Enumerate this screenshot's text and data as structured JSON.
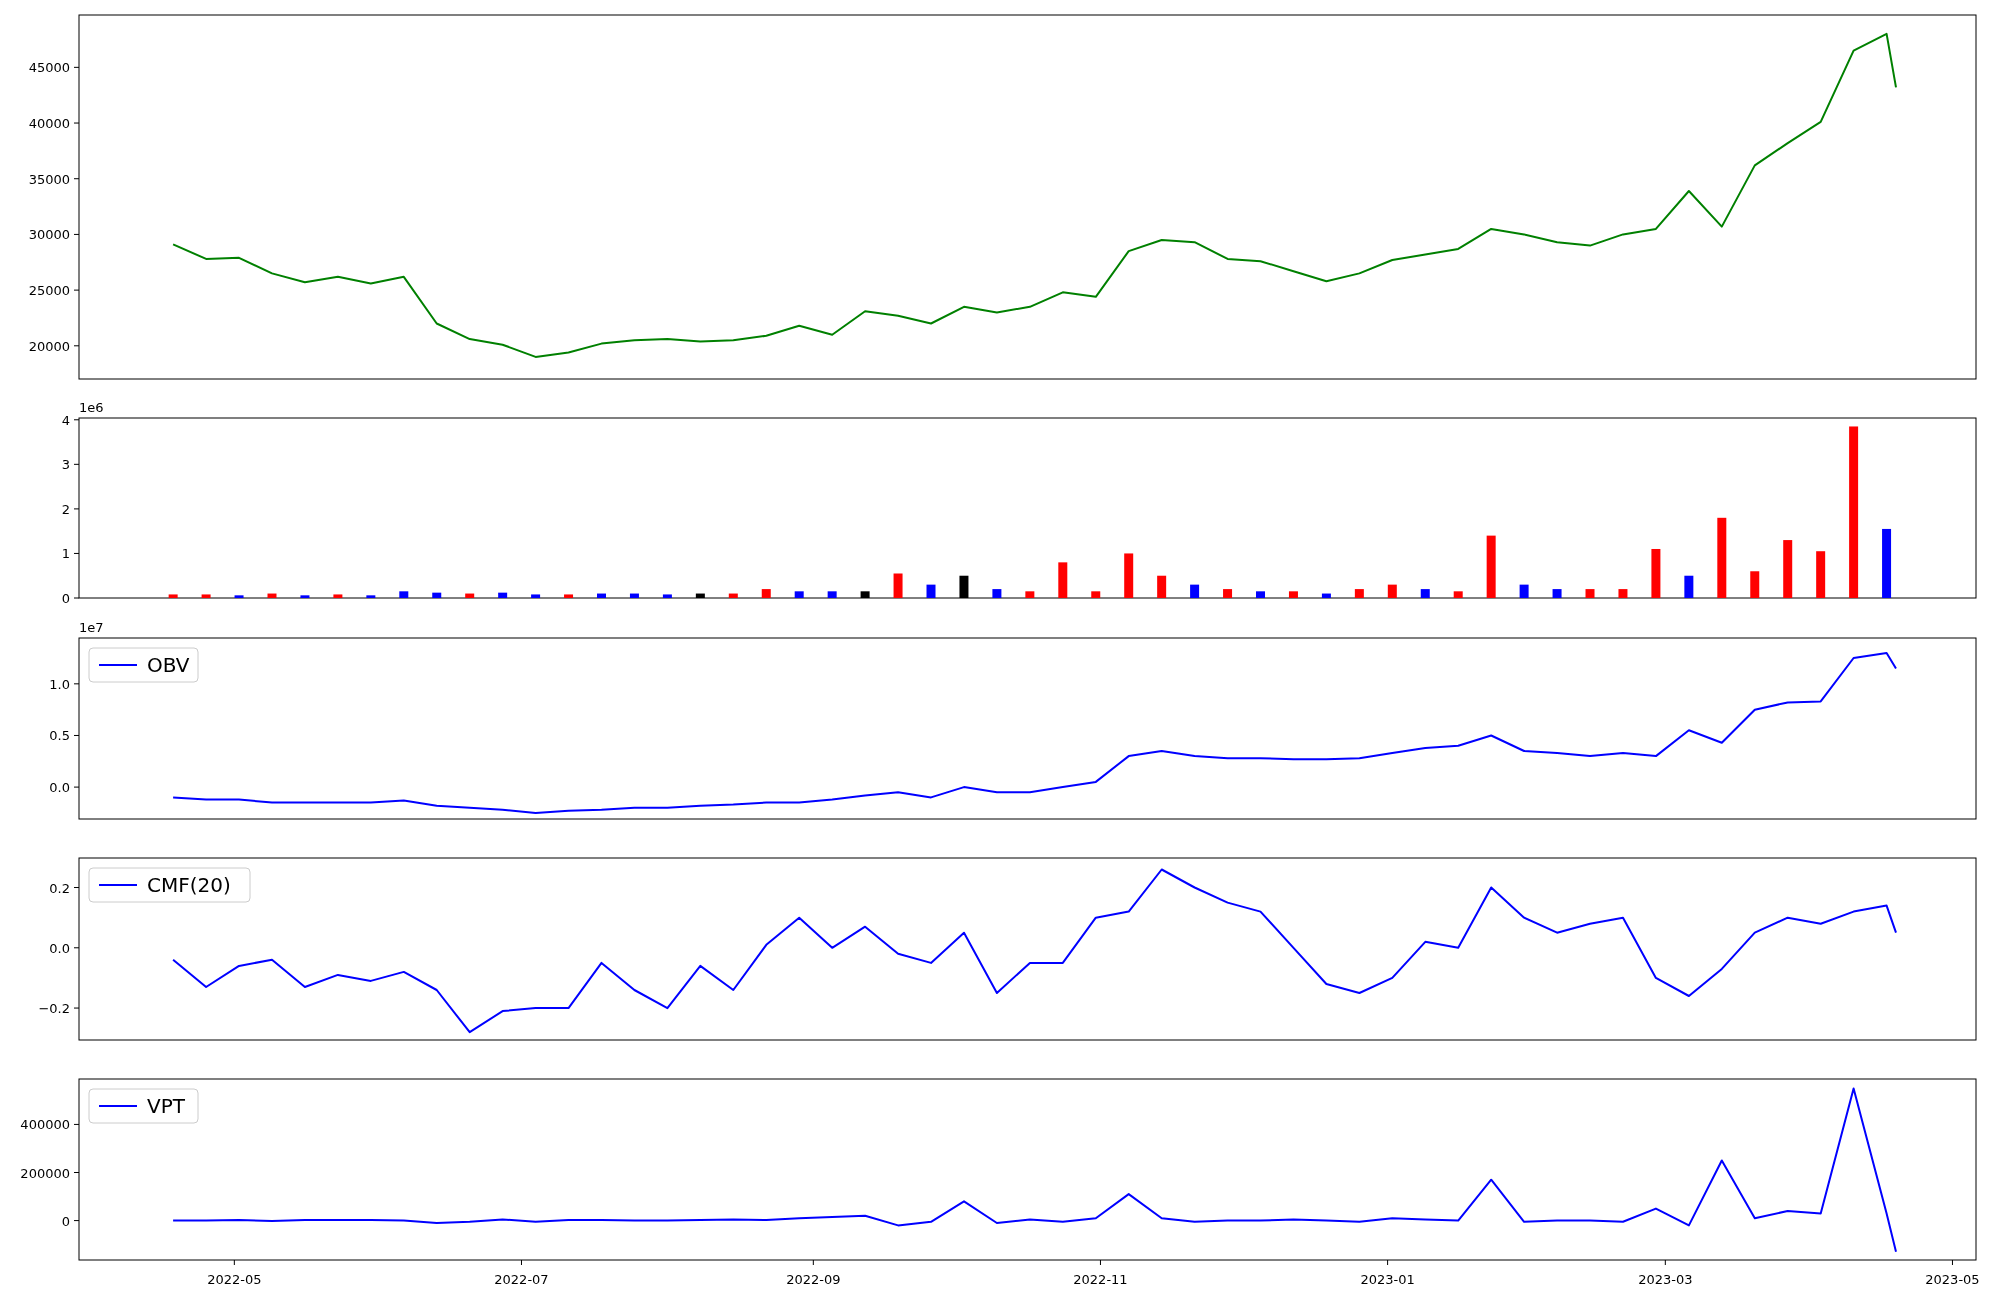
{
  "figure": {
    "panels": [
      {
        "chart_data": {
          "type": "line",
          "xlim": [
            "2022-03-29",
            "2023-05-06"
          ],
          "ylim": [
            17020,
            49700
          ],
          "yticks": [
            20000,
            25000,
            30000,
            35000,
            40000,
            45000
          ],
          "x": [
            "2022-04-18",
            "2022-04-25",
            "2022-05-02",
            "2022-05-09",
            "2022-05-16",
            "2022-05-23",
            "2022-05-30",
            "2022-06-06",
            "2022-06-13",
            "2022-06-20",
            "2022-06-27",
            "2022-07-04",
            "2022-07-11",
            "2022-07-18",
            "2022-07-25",
            "2022-08-01",
            "2022-08-08",
            "2022-08-15",
            "2022-08-22",
            "2022-08-29",
            "2022-09-05",
            "2022-09-12",
            "2022-09-19",
            "2022-09-26",
            "2022-10-03",
            "2022-10-10",
            "2022-10-17",
            "2022-10-24",
            "2022-10-31",
            "2022-11-07",
            "2022-11-14",
            "2022-11-21",
            "2022-11-28",
            "2022-12-05",
            "2022-12-12",
            "2022-12-19",
            "2022-12-26",
            "2023-01-02",
            "2023-01-09",
            "2023-01-16",
            "2023-01-23",
            "2023-01-30",
            "2023-02-06",
            "2023-02-13",
            "2023-02-20",
            "2023-02-27",
            "2023-03-06",
            "2023-03-13",
            "2023-03-20",
            "2023-03-27",
            "2023-04-03",
            "2023-04-10",
            "2023-04-17",
            "2023-04-19"
          ],
          "series": [
            {
              "color": "#008000",
              "values": [
                29100,
                27800,
                27900,
                26500,
                25700,
                26200,
                25600,
                26200,
                22000,
                20600,
                20100,
                19000,
                19400,
                20200,
                20500,
                20600,
                20400,
                20500,
                20900,
                21800,
                21000,
                23100,
                22700,
                22000,
                23500,
                23000,
                23500,
                24800,
                24400,
                28500,
                29500,
                29300,
                27800,
                27600,
                26700,
                25800,
                26500,
                27700,
                28200,
                28700,
                30500,
                30000,
                29300,
                29000,
                30000,
                30500,
                33900,
                30700,
                36200,
                38200,
                40100,
                46500,
                48000,
                43200
              ]
            }
          ]
        }
      },
      {
        "chart_data": {
          "type": "bar",
          "xlim": [
            "2022-03-29",
            "2023-05-06"
          ],
          "ylim": [
            0,
            4.04
          ],
          "yticks": [
            0,
            1,
            2,
            3,
            4
          ],
          "annotations": [
            {
              "text": "1e6"
            }
          ],
          "x": [
            "2022-04-18",
            "2022-04-25",
            "2022-05-02",
            "2022-05-09",
            "2022-05-16",
            "2022-05-23",
            "2022-05-30",
            "2022-06-06",
            "2022-06-13",
            "2022-06-20",
            "2022-06-27",
            "2022-07-04",
            "2022-07-11",
            "2022-07-18",
            "2022-07-25",
            "2022-08-01",
            "2022-08-08",
            "2022-08-15",
            "2022-08-22",
            "2022-08-29",
            "2022-09-05",
            "2022-09-12",
            "2022-09-19",
            "2022-09-26",
            "2022-10-03",
            "2022-10-10",
            "2022-10-17",
            "2022-10-24",
            "2022-10-31",
            "2022-11-07",
            "2022-11-14",
            "2022-11-21",
            "2022-11-28",
            "2022-12-05",
            "2022-12-12",
            "2022-12-19",
            "2022-12-26",
            "2023-01-02",
            "2023-01-09",
            "2023-01-16",
            "2023-01-23",
            "2023-01-30",
            "2023-02-06",
            "2023-02-13",
            "2023-02-20",
            "2023-02-27",
            "2023-03-06",
            "2023-03-13",
            "2023-03-20",
            "2023-03-27",
            "2023-04-03",
            "2023-04-10",
            "2023-04-17"
          ],
          "series": [
            {
              "color": "#ff0000",
              "values": [
                0.08,
                0.08,
                null,
                0.1,
                null,
                0.08,
                null,
                null,
                null,
                0.1,
                null,
                null,
                0.08,
                null,
                null,
                null,
                null,
                0.1,
                0.2,
                null,
                null,
                null,
                0.55,
                null,
                null,
                null,
                0.15,
                0.8,
                0.15,
                1.0,
                0.5,
                null,
                0.2,
                null,
                0.15,
                null,
                0.2,
                0.3,
                null,
                0.15,
                1.4,
                null,
                null,
                0.2,
                0.2,
                1.1,
                null,
                1.8,
                0.6,
                1.3,
                1.05,
                3.85,
                null
              ]
            },
            {
              "color": "#0000ff",
              "values": [
                null,
                null,
                0.06,
                null,
                0.06,
                null,
                0.06,
                0.15,
                0.12,
                null,
                0.12,
                0.08,
                null,
                0.1,
                0.1,
                0.08,
                null,
                null,
                null,
                0.15,
                0.15,
                null,
                null,
                0.3,
                null,
                0.2,
                null,
                null,
                null,
                null,
                null,
                0.3,
                null,
                0.15,
                null,
                0.1,
                null,
                null,
                0.2,
                null,
                null,
                0.3,
                0.2,
                null,
                null,
                null,
                0.5,
                null,
                null,
                null,
                null,
                null,
                1.55
              ]
            },
            {
              "color": "#000000",
              "values": [
                null,
                null,
                null,
                null,
                null,
                null,
                null,
                null,
                null,
                null,
                null,
                null,
                null,
                null,
                null,
                null,
                0.1,
                null,
                null,
                null,
                null,
                0.15,
                null,
                null,
                0.5,
                null,
                null,
                null,
                null,
                null,
                null,
                null,
                null,
                null,
                null,
                null,
                null,
                null,
                null,
                null,
                null,
                null,
                null,
                null,
                null,
                null,
                null,
                null,
                null,
                null,
                null,
                null,
                null
              ]
            }
          ]
        }
      },
      {
        "chart_data": {
          "type": "line",
          "xlim": [
            "2022-03-29",
            "2023-05-06"
          ],
          "ylim": [
            -0.309,
            1.444
          ],
          "yticks": [
            {
              "value": 0,
              "label": "0.0"
            },
            {
              "value": 0.5,
              "label": "0.5"
            },
            {
              "value": 1,
              "label": "1.0"
            }
          ],
          "annotations": [
            {
              "text": "1e7"
            }
          ],
          "x": [
            "2022-04-18",
            "2022-04-25",
            "2022-05-02",
            "2022-05-09",
            "2022-05-16",
            "2022-05-23",
            "2022-05-30",
            "2022-06-06",
            "2022-06-13",
            "2022-06-20",
            "2022-06-27",
            "2022-07-04",
            "2022-07-11",
            "2022-07-18",
            "2022-07-25",
            "2022-08-01",
            "2022-08-08",
            "2022-08-15",
            "2022-08-22",
            "2022-08-29",
            "2022-09-05",
            "2022-09-12",
            "2022-09-19",
            "2022-09-26",
            "2022-10-03",
            "2022-10-10",
            "2022-10-17",
            "2022-10-24",
            "2022-10-31",
            "2022-11-07",
            "2022-11-14",
            "2022-11-21",
            "2022-11-28",
            "2022-12-05",
            "2022-12-12",
            "2022-12-19",
            "2022-12-26",
            "2023-01-02",
            "2023-01-09",
            "2023-01-16",
            "2023-01-23",
            "2023-01-30",
            "2023-02-06",
            "2023-02-13",
            "2023-02-20",
            "2023-02-27",
            "2023-03-06",
            "2023-03-13",
            "2023-03-20",
            "2023-03-27",
            "2023-04-03",
            "2023-04-10",
            "2023-04-17",
            "2023-04-19"
          ],
          "series": [
            {
              "name": "OBV",
              "color": "#0000ff",
              "values": [
                -0.1,
                -0.12,
                -0.12,
                -0.15,
                -0.15,
                -0.15,
                -0.15,
                -0.13,
                -0.18,
                -0.2,
                -0.22,
                -0.25,
                -0.23,
                -0.22,
                -0.2,
                -0.2,
                -0.18,
                -0.17,
                -0.15,
                -0.15,
                -0.12,
                -0.08,
                -0.05,
                -0.1,
                0,
                -0.05,
                -0.05,
                0,
                0.05,
                0.3,
                0.35,
                0.3,
                0.28,
                0.28,
                0.27,
                0.27,
                0.28,
                0.33,
                0.38,
                0.4,
                0.5,
                0.35,
                0.33,
                0.3,
                0.33,
                0.3,
                0.55,
                0.43,
                0.75,
                0.82,
                0.83,
                1.25,
                1.3,
                1.15
              ]
            }
          ]
        }
      },
      {
        "chart_data": {
          "type": "line",
          "xlim": [
            "2022-03-29",
            "2023-05-06"
          ],
          "ylim": [
            -0.306,
            0.298
          ],
          "yticks": [
            {
              "value": -0.2,
              "label": "−0.2"
            },
            {
              "value": 0,
              "label": "0.0"
            },
            {
              "value": 0.2,
              "label": "0.2"
            }
          ],
          "x": [
            "2022-04-18",
            "2022-04-25",
            "2022-05-02",
            "2022-05-09",
            "2022-05-16",
            "2022-05-23",
            "2022-05-30",
            "2022-06-06",
            "2022-06-13",
            "2022-06-20",
            "2022-06-27",
            "2022-07-04",
            "2022-07-11",
            "2022-07-18",
            "2022-07-25",
            "2022-08-01",
            "2022-08-08",
            "2022-08-15",
            "2022-08-22",
            "2022-08-29",
            "2022-09-05",
            "2022-09-12",
            "2022-09-19",
            "2022-09-26",
            "2022-10-03",
            "2022-10-10",
            "2022-10-17",
            "2022-10-24",
            "2022-10-31",
            "2022-11-07",
            "2022-11-14",
            "2022-11-21",
            "2022-11-28",
            "2022-12-05",
            "2022-12-12",
            "2022-12-19",
            "2022-12-26",
            "2023-01-02",
            "2023-01-09",
            "2023-01-16",
            "2023-01-23",
            "2023-01-30",
            "2023-02-06",
            "2023-02-13",
            "2023-02-20",
            "2023-02-27",
            "2023-03-06",
            "2023-03-13",
            "2023-03-20",
            "2023-03-27",
            "2023-04-03",
            "2023-04-10",
            "2023-04-17",
            "2023-04-19"
          ],
          "series": [
            {
              "name": "CMF(20)",
              "color": "#0000ff",
              "values": [
                -0.04,
                -0.13,
                -0.06,
                -0.04,
                -0.13,
                -0.09,
                -0.11,
                -0.08,
                -0.14,
                -0.28,
                -0.21,
                -0.2,
                -0.2,
                -0.05,
                -0.14,
                -0.2,
                -0.06,
                -0.14,
                0.01,
                0.1,
                0,
                0.07,
                -0.02,
                -0.05,
                0.05,
                -0.15,
                -0.05,
                -0.05,
                0.1,
                0.12,
                0.26,
                0.2,
                0.15,
                0.12,
                0,
                -0.12,
                -0.15,
                -0.1,
                0.02,
                0,
                0.2,
                0.1,
                0.05,
                0.08,
                0.1,
                -0.1,
                -0.16,
                -0.07,
                0.05,
                0.1,
                0.08,
                0.12,
                0.14,
                0.05
              ]
            }
          ]
        }
      },
      {
        "chart_data": {
          "type": "line",
          "xlim": [
            "2022-03-29",
            "2023-05-06"
          ],
          "ylim": [
            -164000,
            589000
          ],
          "yticks": [
            0,
            200000,
            400000
          ],
          "xticks": [
            {
              "value": "2022-05-01",
              "label": "2022-05"
            },
            {
              "value": "2022-07-01",
              "label": "2022-07"
            },
            {
              "value": "2022-09-01",
              "label": "2022-09"
            },
            {
              "value": "2022-11-01",
              "label": "2022-11"
            },
            {
              "value": "2023-01-01",
              "label": "2023-01"
            },
            {
              "value": "2023-03-01",
              "label": "2023-03"
            },
            {
              "value": "2023-05-01",
              "label": "2023-05"
            }
          ],
          "x": [
            "2022-04-18",
            "2022-04-25",
            "2022-05-02",
            "2022-05-09",
            "2022-05-16",
            "2022-05-23",
            "2022-05-30",
            "2022-06-06",
            "2022-06-13",
            "2022-06-20",
            "2022-06-27",
            "2022-07-04",
            "2022-07-11",
            "2022-07-18",
            "2022-07-25",
            "2022-08-01",
            "2022-08-08",
            "2022-08-15",
            "2022-08-22",
            "2022-08-29",
            "2022-09-05",
            "2022-09-12",
            "2022-09-19",
            "2022-09-26",
            "2022-10-03",
            "2022-10-10",
            "2022-10-17",
            "2022-10-24",
            "2022-10-31",
            "2022-11-07",
            "2022-11-14",
            "2022-11-21",
            "2022-11-28",
            "2022-12-05",
            "2022-12-12",
            "2022-12-19",
            "2022-12-26",
            "2023-01-02",
            "2023-01-09",
            "2023-01-16",
            "2023-01-23",
            "2023-01-30",
            "2023-02-06",
            "2023-02-13",
            "2023-02-20",
            "2023-02-27",
            "2023-03-06",
            "2023-03-13",
            "2023-03-20",
            "2023-03-27",
            "2023-04-03",
            "2023-04-10",
            "2023-04-17",
            "2023-04-19"
          ],
          "series": [
            {
              "name": "VPT",
              "color": "#0000ff",
              "values": [
                0,
                0,
                3000,
                -2000,
                2000,
                2000,
                3000,
                0,
                -10000,
                -5000,
                5000,
                -5000,
                2000,
                2000,
                0,
                0,
                3000,
                5000,
                2000,
                10000,
                15000,
                20000,
                -20000,
                -5000,
                80000,
                -10000,
                5000,
                -5000,
                10000,
                110000,
                10000,
                -5000,
                0,
                0,
                5000,
                0,
                -5000,
                10000,
                5000,
                0,
                170000,
                -5000,
                0,
                0,
                -5000,
                50000,
                -20000,
                250000,
                10000,
                40000,
                30000,
                550000,
                30000,
                -130000
              ]
            }
          ]
        }
      }
    ]
  }
}
